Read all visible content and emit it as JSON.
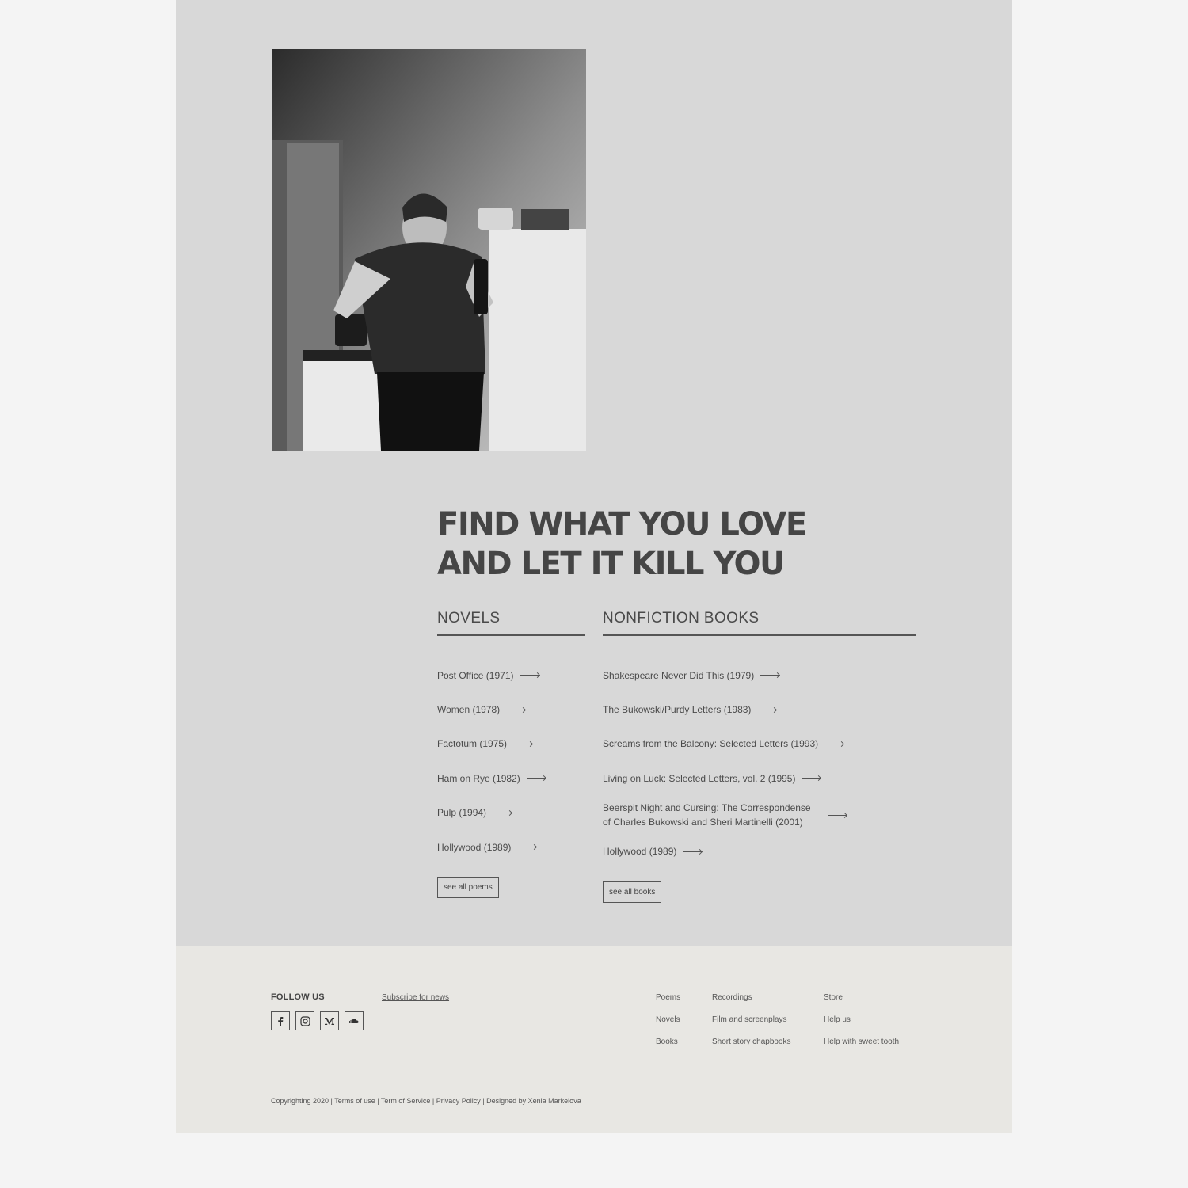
{
  "hero": {
    "photo_alt": "",
    "headline_line1": "FIND WHAT YOU LOVE",
    "headline_line2": "AND LET IT KILL YOU"
  },
  "novels": {
    "title": "NOVELS",
    "items": [
      "Post Office (1971)",
      "Women (1978)",
      "Factotum (1975)",
      "Ham on Rye (1982)",
      "Pulp (1994)",
      "Hollywood (1989)"
    ],
    "button": "see all poems"
  },
  "nonfiction": {
    "title": "NONFICTION BOOKS",
    "items": [
      "Shakespeare Never Did This (1979)",
      "The Bukowski/Purdy Letters (1983)",
      "Screams from the Balcony: Selected Letters (1993)",
      "Living on Luck: Selected Letters, vol. 2 (1995)",
      "Beerspit Night and Cursing: The Correspondense of Charles Bukowski and Sheri Martinelli (2001)",
      "Hollywood (1989)"
    ],
    "button": "see all books"
  },
  "footer": {
    "follow_label": "FOLLOW US",
    "socials": [
      "facebook-icon",
      "instagram-icon",
      "medium-icon",
      "soundcloud-icon"
    ],
    "subscribe": "Subscribe for news",
    "links_col1": [
      "Poems",
      "Novels",
      "Books"
    ],
    "links_col2": [
      "Recordings",
      "Film and screenplays",
      "Short story chapbooks"
    ],
    "links_col3": [
      "Store",
      "Help us",
      "Help with sweet tooth"
    ],
    "copyright": "Copyrighting 2020 | Terms of use | Term of Service | Privacy Policy | Designed by Xenia Markelova |"
  }
}
